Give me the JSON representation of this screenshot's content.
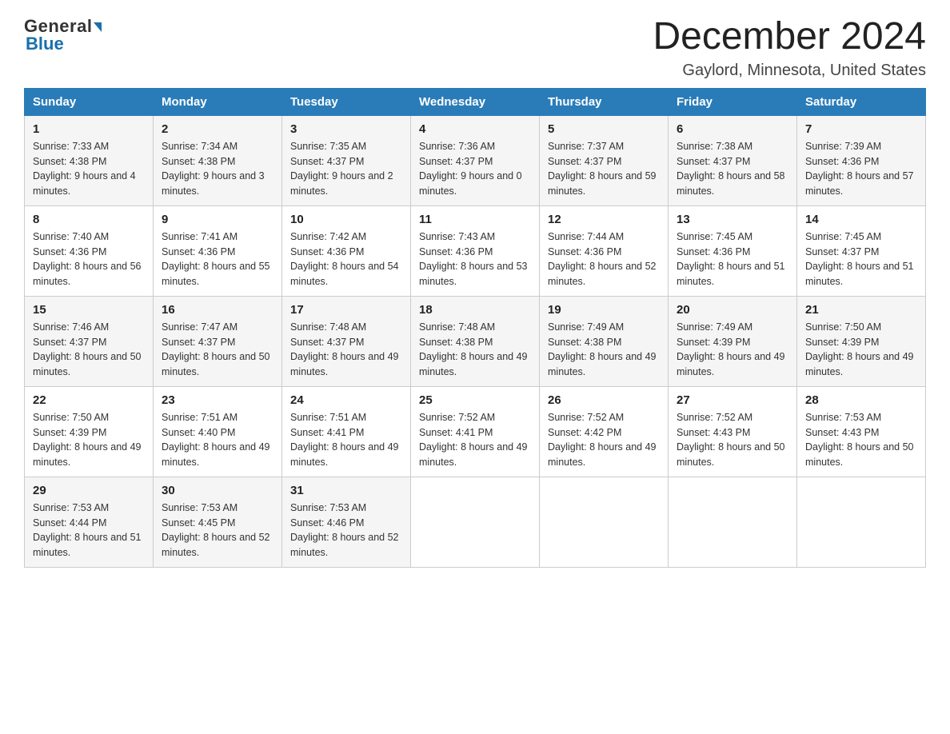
{
  "header": {
    "logo_text_general": "General",
    "logo_text_blue": "Blue",
    "title": "December 2024",
    "subtitle": "Gaylord, Minnesota, United States"
  },
  "columns": [
    "Sunday",
    "Monday",
    "Tuesday",
    "Wednesday",
    "Thursday",
    "Friday",
    "Saturday"
  ],
  "weeks": [
    [
      {
        "day": "1",
        "sunrise": "7:33 AM",
        "sunset": "4:38 PM",
        "daylight": "9 hours and 4 minutes."
      },
      {
        "day": "2",
        "sunrise": "7:34 AM",
        "sunset": "4:38 PM",
        "daylight": "9 hours and 3 minutes."
      },
      {
        "day": "3",
        "sunrise": "7:35 AM",
        "sunset": "4:37 PM",
        "daylight": "9 hours and 2 minutes."
      },
      {
        "day": "4",
        "sunrise": "7:36 AM",
        "sunset": "4:37 PM",
        "daylight": "9 hours and 0 minutes."
      },
      {
        "day": "5",
        "sunrise": "7:37 AM",
        "sunset": "4:37 PM",
        "daylight": "8 hours and 59 minutes."
      },
      {
        "day": "6",
        "sunrise": "7:38 AM",
        "sunset": "4:37 PM",
        "daylight": "8 hours and 58 minutes."
      },
      {
        "day": "7",
        "sunrise": "7:39 AM",
        "sunset": "4:36 PM",
        "daylight": "8 hours and 57 minutes."
      }
    ],
    [
      {
        "day": "8",
        "sunrise": "7:40 AM",
        "sunset": "4:36 PM",
        "daylight": "8 hours and 56 minutes."
      },
      {
        "day": "9",
        "sunrise": "7:41 AM",
        "sunset": "4:36 PM",
        "daylight": "8 hours and 55 minutes."
      },
      {
        "day": "10",
        "sunrise": "7:42 AM",
        "sunset": "4:36 PM",
        "daylight": "8 hours and 54 minutes."
      },
      {
        "day": "11",
        "sunrise": "7:43 AM",
        "sunset": "4:36 PM",
        "daylight": "8 hours and 53 minutes."
      },
      {
        "day": "12",
        "sunrise": "7:44 AM",
        "sunset": "4:36 PM",
        "daylight": "8 hours and 52 minutes."
      },
      {
        "day": "13",
        "sunrise": "7:45 AM",
        "sunset": "4:36 PM",
        "daylight": "8 hours and 51 minutes."
      },
      {
        "day": "14",
        "sunrise": "7:45 AM",
        "sunset": "4:37 PM",
        "daylight": "8 hours and 51 minutes."
      }
    ],
    [
      {
        "day": "15",
        "sunrise": "7:46 AM",
        "sunset": "4:37 PM",
        "daylight": "8 hours and 50 minutes."
      },
      {
        "day": "16",
        "sunrise": "7:47 AM",
        "sunset": "4:37 PM",
        "daylight": "8 hours and 50 minutes."
      },
      {
        "day": "17",
        "sunrise": "7:48 AM",
        "sunset": "4:37 PM",
        "daylight": "8 hours and 49 minutes."
      },
      {
        "day": "18",
        "sunrise": "7:48 AM",
        "sunset": "4:38 PM",
        "daylight": "8 hours and 49 minutes."
      },
      {
        "day": "19",
        "sunrise": "7:49 AM",
        "sunset": "4:38 PM",
        "daylight": "8 hours and 49 minutes."
      },
      {
        "day": "20",
        "sunrise": "7:49 AM",
        "sunset": "4:39 PM",
        "daylight": "8 hours and 49 minutes."
      },
      {
        "day": "21",
        "sunrise": "7:50 AM",
        "sunset": "4:39 PM",
        "daylight": "8 hours and 49 minutes."
      }
    ],
    [
      {
        "day": "22",
        "sunrise": "7:50 AM",
        "sunset": "4:39 PM",
        "daylight": "8 hours and 49 minutes."
      },
      {
        "day": "23",
        "sunrise": "7:51 AM",
        "sunset": "4:40 PM",
        "daylight": "8 hours and 49 minutes."
      },
      {
        "day": "24",
        "sunrise": "7:51 AM",
        "sunset": "4:41 PM",
        "daylight": "8 hours and 49 minutes."
      },
      {
        "day": "25",
        "sunrise": "7:52 AM",
        "sunset": "4:41 PM",
        "daylight": "8 hours and 49 minutes."
      },
      {
        "day": "26",
        "sunrise": "7:52 AM",
        "sunset": "4:42 PM",
        "daylight": "8 hours and 49 minutes."
      },
      {
        "day": "27",
        "sunrise": "7:52 AM",
        "sunset": "4:43 PM",
        "daylight": "8 hours and 50 minutes."
      },
      {
        "day": "28",
        "sunrise": "7:53 AM",
        "sunset": "4:43 PM",
        "daylight": "8 hours and 50 minutes."
      }
    ],
    [
      {
        "day": "29",
        "sunrise": "7:53 AM",
        "sunset": "4:44 PM",
        "daylight": "8 hours and 51 minutes."
      },
      {
        "day": "30",
        "sunrise": "7:53 AM",
        "sunset": "4:45 PM",
        "daylight": "8 hours and 52 minutes."
      },
      {
        "day": "31",
        "sunrise": "7:53 AM",
        "sunset": "4:46 PM",
        "daylight": "8 hours and 52 minutes."
      },
      null,
      null,
      null,
      null
    ]
  ]
}
